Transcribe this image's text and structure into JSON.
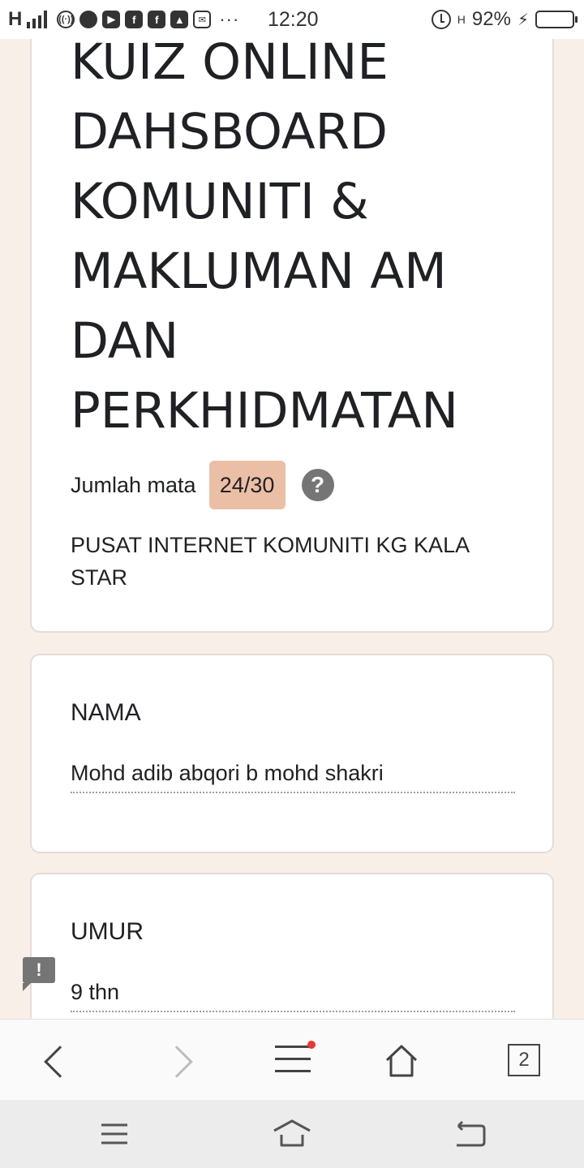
{
  "status_bar": {
    "network": "H",
    "time": "12:20",
    "battery_text": "92%",
    "battery_level": 0.92,
    "secondary_network": "H",
    "more_icon": "···",
    "icons": [
      "hotspot-icon",
      "chat-icon",
      "youtube-icon",
      "facebook-icon",
      "facebook-icon",
      "gallery-icon",
      "mail-icon"
    ]
  },
  "form": {
    "title": "KUIZ ONLINE DAHSBOARD KOMUNITI & MAKLUMAN AM DAN PERKHIDMATAN",
    "score_label": "Jumlah mata",
    "score_value": "24/30",
    "help_glyph": "?",
    "description": " PUSAT INTERNET KOMUNITI KG KALA STAR",
    "questions": [
      {
        "label": "NAMA",
        "answer": "Mohd adib abqori b mohd shakri"
      },
      {
        "label": "UMUR",
        "answer": "9 thn"
      }
    ],
    "feedback_glyph": "!"
  },
  "browser_bar": {
    "tab_count": "2",
    "has_notification": true
  },
  "colors": {
    "page_bg": "#f9efe9",
    "score_badge": "#ebbfa5",
    "notification_dot": "#e53935"
  }
}
